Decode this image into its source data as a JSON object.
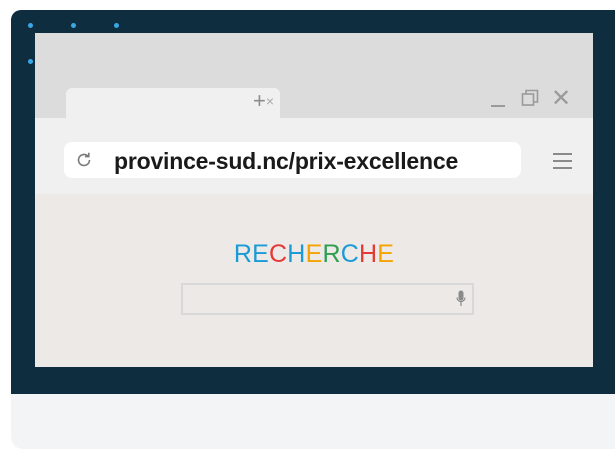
{
  "browser": {
    "tab": {
      "close_glyph": "×"
    },
    "new_tab_glyph": "+",
    "window_controls": {
      "close_glyph": "✕"
    },
    "address_bar": {
      "url": "province-sud.nc/prix-excellence"
    }
  },
  "page": {
    "logo_letters": [
      {
        "char": "R",
        "color": "#1a9ad6"
      },
      {
        "char": "E",
        "color": "#1a9ad6"
      },
      {
        "char": "C",
        "color": "#e53935"
      },
      {
        "char": "H",
        "color": "#1a9ad6"
      },
      {
        "char": "E",
        "color": "#f4a300"
      },
      {
        "char": "R",
        "color": "#2e9e4f"
      },
      {
        "char": "C",
        "color": "#1a9ad6"
      },
      {
        "char": "H",
        "color": "#e53935"
      },
      {
        "char": "E",
        "color": "#f4a300"
      }
    ],
    "search": {
      "value": ""
    }
  },
  "colors": {
    "frame": "#0e2d3f",
    "dots": "#3ba6e6",
    "page_bg": "#ede9e6"
  }
}
